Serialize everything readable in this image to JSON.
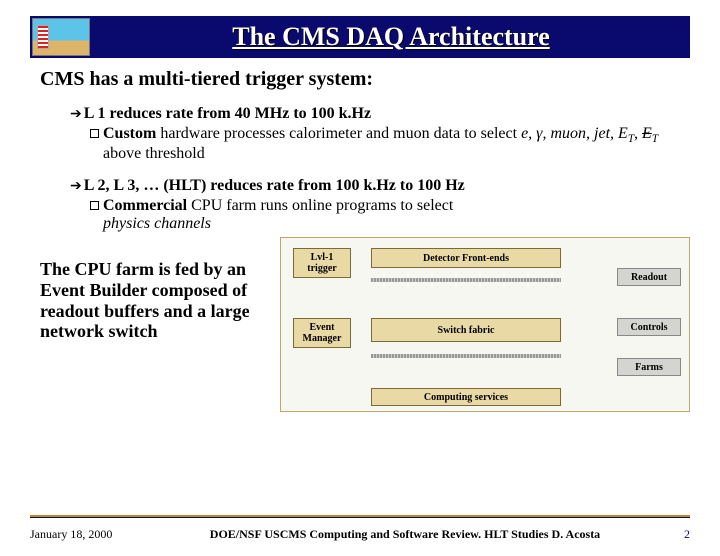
{
  "title": "The CMS DAQ Architecture",
  "subhead": "CMS has a multi-tiered trigger system:",
  "l1": {
    "head_strong": "L 1",
    "head_rest": " reduces rate from 40 MHz to 100 k.Hz",
    "sub_a": "Custom",
    "sub_b": " hardware processes calorimeter and muon data to select ",
    "sub_c": "e, γ, muon, jet, E",
    "sub_d": ", ",
    "sub_e": "E",
    "sub_f": " above threshold"
  },
  "l2": {
    "head_strong": "L 2, L 3, … (HLT)",
    "head_rest": " reduces rate from 100 k.Hz to 100 Hz",
    "sub_a": "Commercial",
    "sub_b": " CPU farm runs online programs to select ",
    "sub_c": "physics channels"
  },
  "left_text": "The CPU farm is fed by an Event Builder composed of readout buffers and a large network switch",
  "diagram": {
    "lvl1": "Lvl-1\ntrigger",
    "evtmgr": "Event\nManager",
    "frontends": "Detector Front-ends",
    "switch": "Switch fabric",
    "readout": "Readout",
    "controls": "Controls",
    "farms": "Farms",
    "services": "Computing services"
  },
  "footer": {
    "date": "January 18, 2000",
    "center": "DOE/NSF USCMS Computing and Software Review. HLT Studies D. Acosta",
    "page": "2"
  }
}
